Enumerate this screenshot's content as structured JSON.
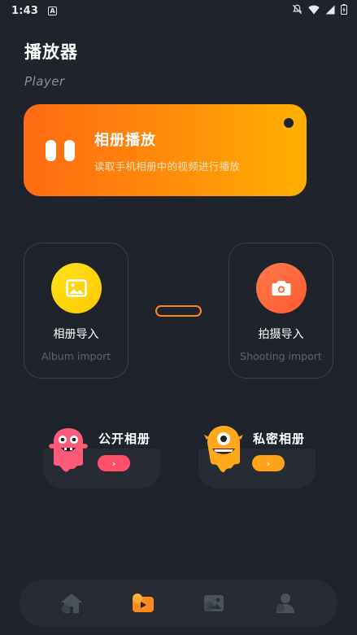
{
  "status_bar": {
    "time": "1:43",
    "notif_glyph": "A"
  },
  "page": {
    "title": "播放器",
    "subtitle": "Player"
  },
  "banner": {
    "title": "相册播放",
    "description": "读取手机相册中的视频进行播放",
    "icon": "pause-icon"
  },
  "import_cards": [
    {
      "label": "相册导入",
      "sublabel": "Album import",
      "icon": "image-icon",
      "color": "#ffd60a"
    },
    {
      "label": "拍摄导入",
      "sublabel": "Shooting import",
      "icon": "camera-icon",
      "color": "#ff6a3d"
    }
  ],
  "albums": [
    {
      "name": "公开相册",
      "go_label": "›",
      "color": "#ff4e66",
      "mascot": "pink-monster-mascot"
    },
    {
      "name": "私密相册",
      "go_label": "›",
      "color": "#ffa21a",
      "mascot": "orange-monster-mascot"
    }
  ],
  "bottom_nav": [
    {
      "icon": "home-icon",
      "active": false
    },
    {
      "icon": "player-icon",
      "active": true
    },
    {
      "icon": "gallery-icon",
      "active": false
    },
    {
      "icon": "profile-icon",
      "active": false
    }
  ],
  "colors": {
    "background": "#1f242c",
    "accent": "#ff8a1c",
    "muted": "#5c636d"
  }
}
